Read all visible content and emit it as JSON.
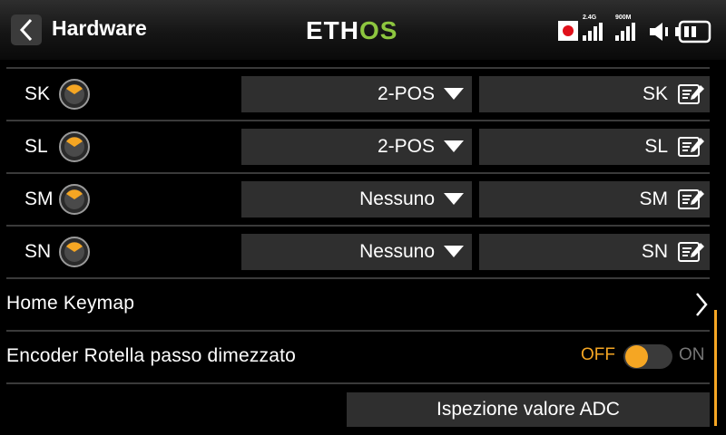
{
  "header": {
    "title": "Hardware",
    "logo_left": "ETH",
    "logo_right": "OS",
    "logo_right_color": "#8dc63f",
    "rssi_24_label": "2.4G",
    "rssi_900_label": "900M"
  },
  "switches": [
    {
      "label": "SK",
      "mode": "2-POS",
      "name": "SK"
    },
    {
      "label": "SL",
      "mode": "2-POS",
      "name": "SL"
    },
    {
      "label": "SM",
      "mode": "Nessuno",
      "name": "SM"
    },
    {
      "label": "SN",
      "mode": "Nessuno",
      "name": "SN"
    }
  ],
  "home_keymap": {
    "label": "Home Keymap"
  },
  "encoder": {
    "label": "Encoder Rotella passo dimezzato",
    "off_label": "OFF",
    "on_label": "ON",
    "state": "OFF"
  },
  "adc_button": {
    "label": "Ispezione valore ADC"
  },
  "colors": {
    "accent": "#f5a623",
    "field_bg": "#2f2f2f",
    "divider": "#3a3a3a"
  }
}
